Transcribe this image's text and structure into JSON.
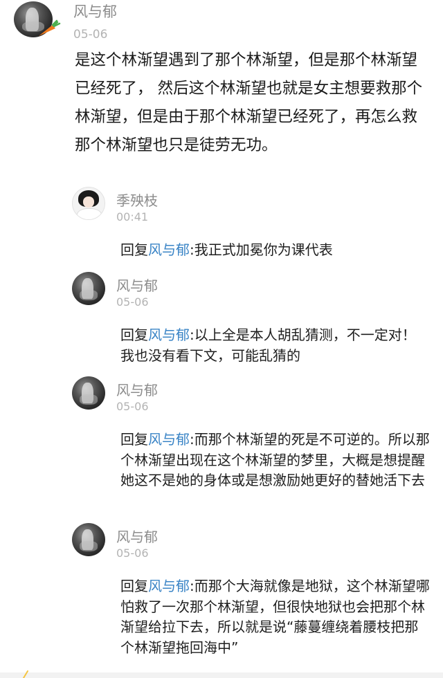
{
  "main_comment": {
    "author": "风与郁",
    "time": "05-06",
    "text": "是这个林渐望遇到了那个林渐望，但是那个林渐望已经死了， 然后这个林渐望也就是女主想要救那个林渐望，但是由于那个林渐望已经死了，再怎么救那个林渐望也只是徒劳无功。"
  },
  "replies": [
    {
      "author": "季殃枝",
      "time": "00:41",
      "reply_prefix": "回复",
      "mention": "风与郁",
      "text": ":我正式加冕你为课代表"
    },
    {
      "author": "风与郁",
      "time": "05-06",
      "reply_prefix": "回复",
      "mention": "风与郁",
      "text": ":以上全是本人胡乱猜测，不一定对！我也没有看下文，可能乱猜的"
    },
    {
      "author": "风与郁",
      "time": "05-06",
      "reply_prefix": "回复",
      "mention": "风与郁",
      "text": ":而那个林渐望的死是不可逆的。所以那个林渐望出现在这个林渐望的梦里，大概是想提醒她这不是她的身体或是想激励她更好的替她活下去"
    },
    {
      "author": "风与郁",
      "time": "05-06",
      "reply_prefix": "回复",
      "mention": "风与郁",
      "text": ":而那个大海就像是地狱，这个林渐望哪怕救了一次那个林渐望，但很快地狱也会把那个林渐望给拉下去，所以就是说“藤蔓缠绕着腰枝把那个林渐望拖回海中”"
    }
  ],
  "colors": {
    "mention": "#3a84c6",
    "name": "#8c8c8c",
    "time": "#b3b3b3"
  },
  "icons": {
    "avatar_badge": "carrot-icon"
  }
}
